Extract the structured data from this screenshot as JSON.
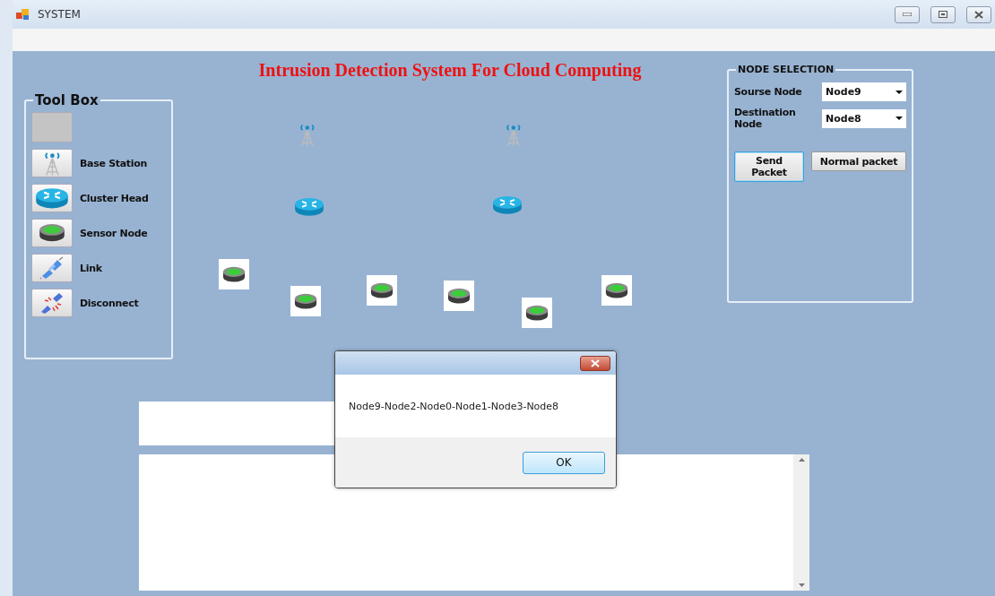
{
  "window": {
    "title": "SYSTEM"
  },
  "heading": "Intrusion Detection System For Cloud Computing",
  "toolbox": {
    "title": "Tool Box",
    "tools": [
      {
        "kind": "blank"
      },
      {
        "kind": "tower",
        "label": "Base Station"
      },
      {
        "kind": "router",
        "label": "Cluster Head"
      },
      {
        "kind": "sensor",
        "label": "Sensor Node"
      },
      {
        "kind": "link",
        "label": "Link"
      },
      {
        "kind": "disconnect",
        "label": "Disconnect"
      }
    ]
  },
  "canvas": {
    "nodes": [
      {
        "kind": "tower"
      },
      {
        "kind": "tower"
      },
      {
        "kind": "router"
      },
      {
        "kind": "router"
      },
      {
        "kind": "sensor"
      },
      {
        "kind": "sensor"
      },
      {
        "kind": "sensor"
      },
      {
        "kind": "sensor"
      },
      {
        "kind": "sensor"
      },
      {
        "kind": "sensor"
      }
    ]
  },
  "node_selection": {
    "title": "NODE SELECTION",
    "source": {
      "label": "Sourse Node",
      "value": "Node9"
    },
    "destination": {
      "label": "Destination Node",
      "value": "Node8"
    },
    "buttons": [
      {
        "label": "Send Packet",
        "focused": true
      },
      {
        "label": "Normal packet",
        "focused": false
      }
    ]
  },
  "dialog": {
    "message": "Node9-Node2-Node0-Node1-Node3-Node8",
    "button": "OK"
  }
}
